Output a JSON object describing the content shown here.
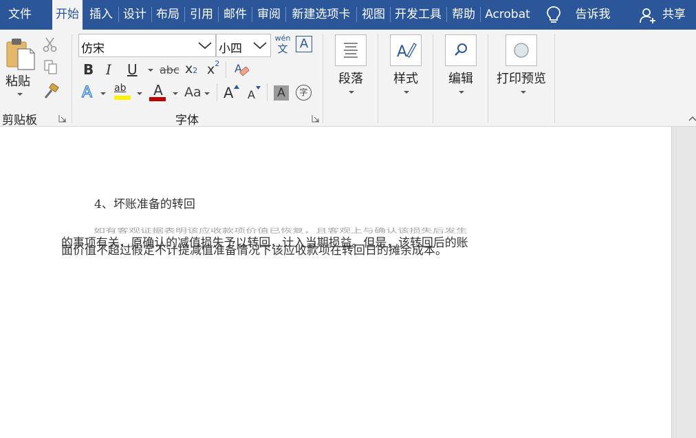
{
  "tabs": [
    {
      "label": "文件",
      "active": false
    },
    {
      "label": "开始",
      "active": true
    },
    {
      "label": "插入",
      "active": false
    },
    {
      "label": "设计",
      "active": false
    },
    {
      "label": "布局",
      "active": false
    },
    {
      "label": "引用",
      "active": false
    },
    {
      "label": "邮件",
      "active": false
    },
    {
      "label": "审阅",
      "active": false
    },
    {
      "label": "新建选项卡",
      "active": false
    },
    {
      "label": "视图",
      "active": false
    },
    {
      "label": "开发工具",
      "active": false
    },
    {
      "label": "帮助",
      "active": false
    },
    {
      "label": "Acrobat",
      "active": false
    }
  ],
  "tellme": "告诉我",
  "share": "共享",
  "clipboard": {
    "paste": "粘贴",
    "group_label": "剪贴板"
  },
  "font": {
    "name": "仿宋",
    "size": "小四",
    "phonetic_top": "wén",
    "phonetic_bottom": "文",
    "border_char": "A",
    "bold": "B",
    "italic": "I",
    "underline": "U",
    "strike": "abc",
    "sub": "x",
    "sub_mark": "2",
    "sup": "x",
    "sup_mark": "2",
    "effects": "A",
    "highlight": "ab",
    "color": "A",
    "case": "Aa",
    "grow": "A",
    "shrink": "A",
    "shade": "A",
    "enclose": "字",
    "group_label": "字体",
    "highlight_color": "#fff200",
    "font_color": "#c00000"
  },
  "paragraph": {
    "label": "段落"
  },
  "styles": {
    "label": "样式"
  },
  "editing": {
    "label": "编辑"
  },
  "print_preview": {
    "label": "打印预览"
  },
  "document": {
    "heading": "4、坏账准备的转回",
    "ghost_line": "如有客观证据表明该应收款项价值已恢复，且客观上与确认该损失后发生",
    "line1": "的事项有关，原确认的减值损失予以转回，计入当期损益。但是，该转回后的账",
    "line2": "面价值不超过假定不计提减值准备情况下该应收款项在转回日的摊余成本。"
  }
}
